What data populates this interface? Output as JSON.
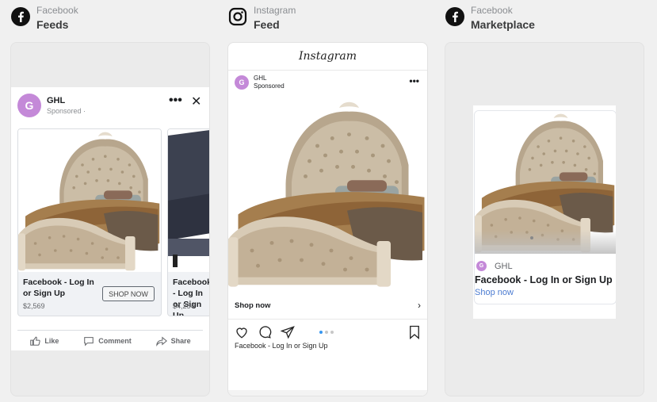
{
  "columns": [
    {
      "platform": "Facebook",
      "placement": "Feeds",
      "icon": "facebook-icon"
    },
    {
      "platform": "Instagram",
      "placement": "Feed",
      "icon": "instagram-icon"
    },
    {
      "platform": "Facebook",
      "placement": "Marketplace",
      "icon": "facebook-icon"
    }
  ],
  "fb_feed": {
    "avatar_letter": "G",
    "page_name": "GHL",
    "sponsored": "Sponsored ·",
    "cards": [
      {
        "title": "Facebook - Log In or Sign Up",
        "price": "$2,569",
        "cta": "SHOP NOW"
      },
      {
        "title": "Facebook - Log In or Sign Up",
        "price": "$4,254"
      }
    ],
    "actions": {
      "like": "Like",
      "comment": "Comment",
      "share": "Share"
    }
  },
  "ig_feed": {
    "logo_text": "Instagram",
    "avatar_letter": "G",
    "page_name": "GHL",
    "sponsored": "Sponsored",
    "shop_label": "Shop now",
    "caption": "Facebook - Log In or Sign Up"
  },
  "marketplace": {
    "avatar_letter": "G",
    "page_name": "GHL",
    "title": "Facebook - Log In or Sign Up",
    "cta": "Shop now"
  },
  "colors": {
    "avatar": "#c489d8",
    "link": "#4b7bd1",
    "ig_active_dot": "#3897f0"
  }
}
